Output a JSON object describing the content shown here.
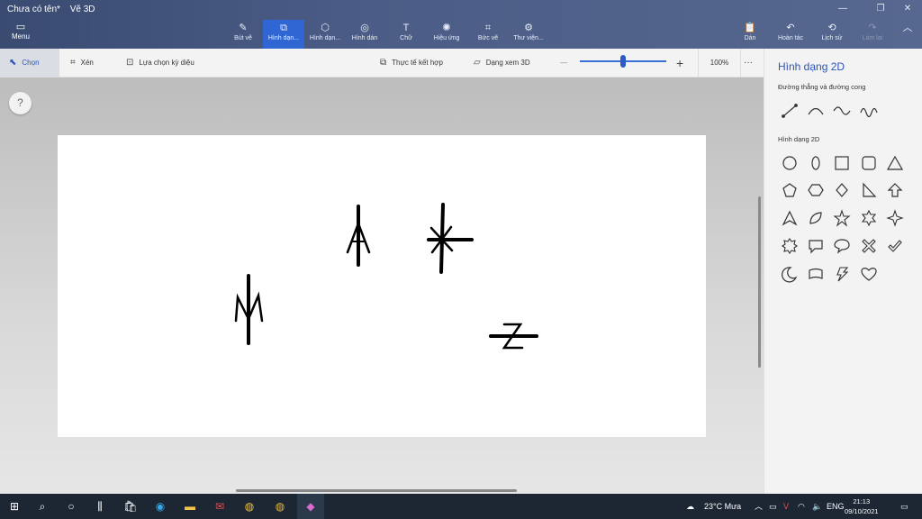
{
  "window": {
    "title": "Chưa có tên*",
    "app_name": "Vẽ 3D",
    "controls": [
      "—",
      "❐",
      "✕"
    ]
  },
  "menu": {
    "label": "Menu"
  },
  "ribbon": {
    "tools": [
      {
        "label": "Bút vẽ",
        "icon": "brush-icon"
      },
      {
        "label": "Hình dạn...",
        "icon": "shapes-2d-icon",
        "active": true
      },
      {
        "label": "Hình dạn...",
        "icon": "shapes-3d-icon"
      },
      {
        "label": "Hình dán",
        "icon": "sticker-icon"
      },
      {
        "label": "Chữ",
        "icon": "text-icon"
      },
      {
        "label": "Hiệu ứng",
        "icon": "effects-icon"
      },
      {
        "label": "Bức vẽ",
        "icon": "canvas-icon"
      },
      {
        "label": "Thư viện...",
        "icon": "library-icon"
      }
    ],
    "right": [
      {
        "label": "Dán",
        "icon": "paste-icon"
      },
      {
        "label": "Hoàn tác",
        "icon": "undo-icon"
      },
      {
        "label": "Lịch sử",
        "icon": "history-icon"
      },
      {
        "label": "Làm lại",
        "icon": "redo-icon"
      }
    ]
  },
  "toolbar": {
    "select": "Chọn",
    "crop": "Xén",
    "magic_select": "Lựa chọn kỳ diệu",
    "mixed_reality": "Thực tế kết hợp",
    "view_3d": "Dạng xem 3D",
    "zoom_minus": "—",
    "zoom_plus": "+",
    "zoom_value": "100%",
    "zoom_fraction": 0.5,
    "more": "···"
  },
  "help": "?",
  "panel": {
    "title": "Hình dạng 2D",
    "lines_section": "Đường thẳng và đường cong",
    "shapes_section": "Hình dạng 2D",
    "line_shapes": [
      "line-icon",
      "curve-icon",
      "s-curve-icon",
      "wave-curve-icon"
    ],
    "shapes_2d": [
      "circle-icon",
      "ellipse-icon",
      "square-icon",
      "rounded-square-icon",
      "triangle-icon",
      "pentagon-icon",
      "hexagon-icon",
      "diamond-icon",
      "right-triangle-icon",
      "arrow-up-icon",
      "arrowhead-icon",
      "leaf-icon",
      "star5-icon",
      "star6-icon",
      "star4-icon",
      "burst-icon",
      "speech-rect-icon",
      "speech-oval-icon",
      "cross-icon",
      "check-icon",
      "crescent-icon",
      "banner-icon",
      "lightning-icon",
      "heart-icon"
    ]
  },
  "canvas_symbols": [
    "A",
    "✱",
    "M",
    "Z"
  ],
  "taskbar": {
    "weather": "23°C Mưa",
    "lang": "ENG",
    "time": "21:13",
    "date": "09/10/2021",
    "apps": [
      "start-icon",
      "search-icon",
      "task-view-icon",
      "widgets-icon",
      "store-icon",
      "edge-icon",
      "file-explorer-icon",
      "mail-icon",
      "chrome-icon",
      "chrome-canary-icon",
      "paint3d-icon"
    ]
  }
}
